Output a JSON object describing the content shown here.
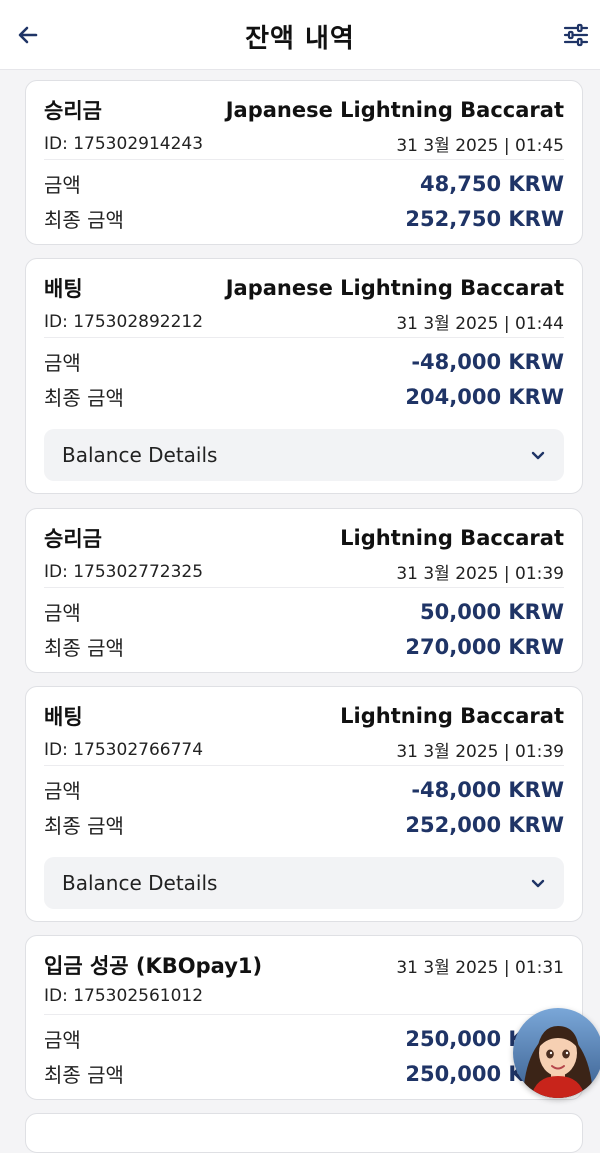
{
  "header": {
    "title": "잔액 내역"
  },
  "cards": [
    {
      "type": "승리금",
      "game": "Japanese Lightning Baccarat",
      "id": "ID: 175302914243",
      "date": "31 3월 2025 | 01:45",
      "amount_label": "금액",
      "amount": "48,750 KRW",
      "final_label": "최종 금액",
      "final": "252,750 KRW"
    },
    {
      "type": "배팅",
      "game": "Japanese Lightning Baccarat",
      "id": "ID: 175302892212",
      "date": "31 3월 2025 | 01:44",
      "amount_label": "금액",
      "amount": "-48,000 KRW",
      "final_label": "최종 금액",
      "final": "204,000 KRW",
      "details": "Balance Details"
    },
    {
      "type": "승리금",
      "game": "Lightning Baccarat",
      "id": "ID: 175302772325",
      "date": "31 3월 2025 | 01:39",
      "amount_label": "금액",
      "amount": "50,000 KRW",
      "final_label": "최종 금액",
      "final": "270,000 KRW"
    },
    {
      "type": "배팅",
      "game": "Lightning Baccarat",
      "id": "ID: 175302766774",
      "date": "31 3월 2025 | 01:39",
      "amount_label": "금액",
      "amount": "-48,000 KRW",
      "final_label": "최종 금액",
      "final": "252,000 KRW",
      "details": "Balance Details"
    },
    {
      "type": "입금 성공 (KBOpay1)",
      "id": "ID: 175302561012",
      "date": "31 3월 2025 | 01:31",
      "amount_label": "금액",
      "amount": "250,000 KRW",
      "final_label": "최종 금액",
      "final": "250,000 KRW"
    }
  ],
  "icons": {
    "back": "arrow-left-icon",
    "filter": "sliders-icon",
    "details": "chevron-down-icon"
  },
  "colors": {
    "accent": "#1f3466"
  }
}
